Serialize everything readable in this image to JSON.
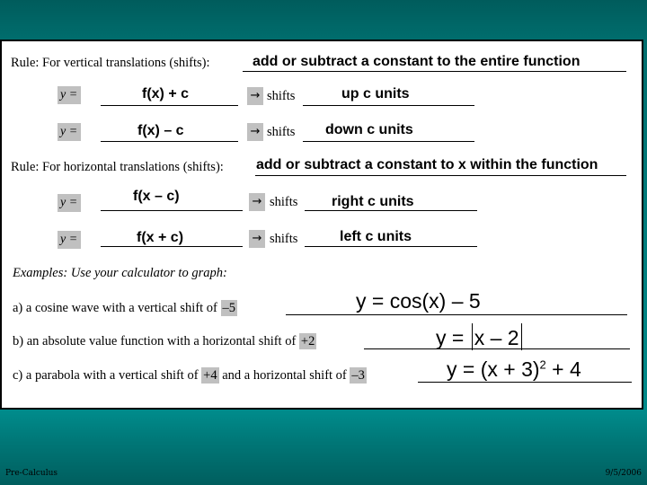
{
  "vertical_rule": {
    "label": "Rule:  For vertical translations (shifts):",
    "answer": "add or subtract a constant to the entire function",
    "rows": [
      {
        "y_label": "y =",
        "expr": "f(x) + c",
        "arrow": "→",
        "shifts_label": "shifts",
        "direction": "up c units"
      },
      {
        "y_label": "y =",
        "expr": "f(x) – c",
        "arrow": "→",
        "shifts_label": "shifts",
        "direction": "down c units"
      }
    ]
  },
  "horizontal_rule": {
    "label": "Rule:  For horizontal translations (shifts):",
    "answer": "add or subtract a constant to x within the function",
    "rows": [
      {
        "y_label": "y =",
        "expr": "f(x – c)",
        "arrow": "→",
        "shifts_label": "shifts",
        "direction": "right c units"
      },
      {
        "y_label": "y =",
        "expr": "f(x + c)",
        "arrow": "→",
        "shifts_label": "shifts",
        "direction": "left  c units"
      }
    ]
  },
  "examples": {
    "heading": "Examples: Use your calculator to graph:",
    "items": [
      {
        "prefix": "a)  a cosine wave with a vertical shift of",
        "value1": "–5",
        "answer_lhs": "y = cos(x) – 5"
      },
      {
        "prefix": "b)  an absolute value function with a horizontal shift of",
        "value1": "+2",
        "answer_lhs": "y = ",
        "answer_inner": "x – 2"
      },
      {
        "prefix": "c)  a parabola with a vertical shift of",
        "value1": "+4",
        "middle": "and a horizontal shift of",
        "value2": "–3",
        "answer_base": "y = (x + 3)",
        "answer_exp": "2",
        "answer_tail": " + 4"
      }
    ]
  },
  "footer": {
    "left": "Pre-Calculus",
    "right": "9/5/2006"
  },
  "colors": {
    "teal_dark": "#005c5c",
    "teal_light": "#008a8a",
    "highlight_gray": "#c0c0c0"
  }
}
